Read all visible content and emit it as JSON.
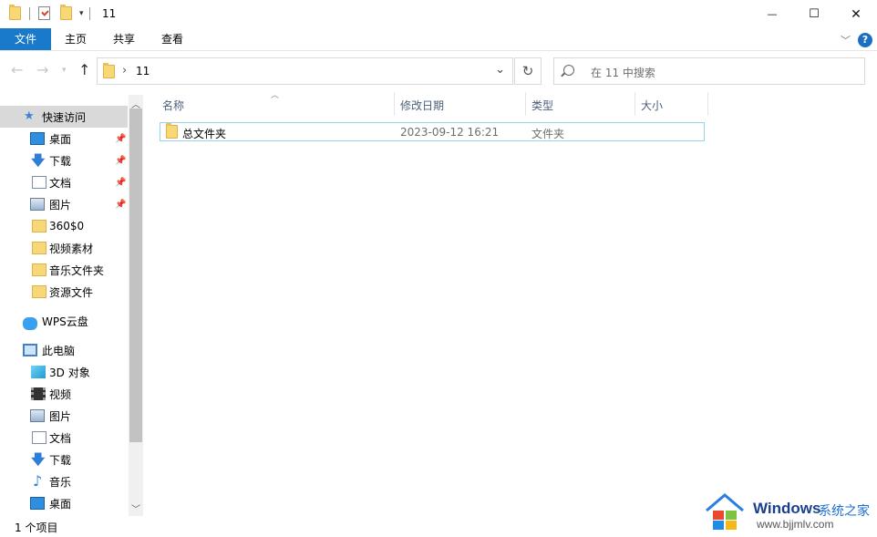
{
  "window": {
    "title": "11",
    "minimize_glyph": "—",
    "maximize_glyph": "☐",
    "close_glyph": "✕"
  },
  "ribbon": {
    "tabs": [
      "文件",
      "主页",
      "共享",
      "查看"
    ],
    "help_glyph": "?",
    "accent": "#1979ca"
  },
  "address": {
    "path": "11",
    "search_placeholder": "在 11 中搜索"
  },
  "sidebar": {
    "quick_access": "快速访问",
    "items": [
      {
        "label": "桌面",
        "icon": "desktop-icon",
        "pinned": true
      },
      {
        "label": "下载",
        "icon": "download-icon",
        "pinned": true
      },
      {
        "label": "文档",
        "icon": "document-icon",
        "pinned": true
      },
      {
        "label": "图片",
        "icon": "picture-icon",
        "pinned": true
      },
      {
        "label": "360$0",
        "icon": "folder-icon",
        "pinned": false
      },
      {
        "label": "视频素材",
        "icon": "folder-icon",
        "pinned": false
      },
      {
        "label": "音乐文件夹",
        "icon": "folder-icon",
        "pinned": false
      },
      {
        "label": "资源文件",
        "icon": "folder-icon",
        "pinned": false
      }
    ],
    "wps": "WPS云盘",
    "this_pc": "此电脑",
    "pc_items": [
      {
        "label": "3D 对象",
        "icon": "3d-objects-icon"
      },
      {
        "label": "视频",
        "icon": "video-icon"
      },
      {
        "label": "图片",
        "icon": "picture-icon"
      },
      {
        "label": "文档",
        "icon": "document-icon"
      },
      {
        "label": "下载",
        "icon": "download-icon"
      },
      {
        "label": "音乐",
        "icon": "music-icon"
      },
      {
        "label": "桌面",
        "icon": "desktop-icon"
      }
    ]
  },
  "columns": [
    "名称",
    "修改日期",
    "类型",
    "大小"
  ],
  "files": [
    {
      "name": "总文件夹",
      "modified": "2023-09-12 16:21",
      "type": "文件夹",
      "size": ""
    }
  ],
  "status": {
    "count": "1 个项目"
  },
  "watermark": {
    "brand": "Windows",
    "subtitle": "系统之家",
    "url": "www.bjjmlv.com"
  }
}
